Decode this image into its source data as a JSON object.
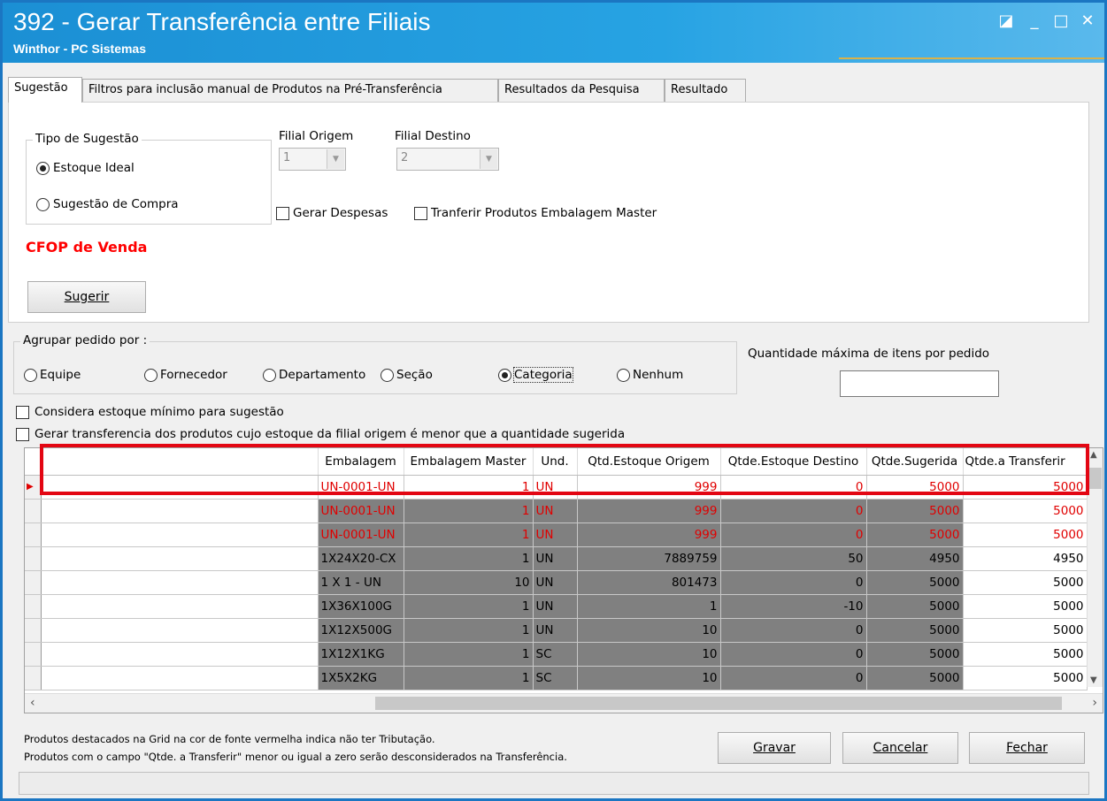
{
  "window": {
    "title": "392 - Gerar Transferência entre Filiais",
    "subtitle": "Winthor - PC Sistemas",
    "controls": {
      "restore": "◪",
      "minimize": "_",
      "maximize": "□",
      "close": "✕"
    }
  },
  "tabs": [
    {
      "label": "Sugestão",
      "active": true
    },
    {
      "label": "Filtros para inclusão manual de Produtos na Pré-Transferência",
      "active": false
    },
    {
      "label": "Resultados da Pesquisa",
      "active": false
    },
    {
      "label": "Resultado",
      "active": false
    }
  ],
  "sugestao": {
    "tipo_label": "Tipo de Sugestão",
    "opt_estoque": "Estoque Ideal",
    "opt_compra": "Sugestão de Compra",
    "filial_origem_label": "Filial Origem",
    "filial_origem_value": "1",
    "filial_destino_label": "Filial Destino",
    "filial_destino_value": "2",
    "gerar_despesas": "Gerar Despesas",
    "transferir_master": "Tranferir Produtos Embalagem Master",
    "cfop": "CFOP de Venda",
    "sugerir": "Sugerir"
  },
  "agrupar": {
    "label": "Agrupar pedido por :",
    "options": [
      "Equipe",
      "Fornecedor",
      "Departamento",
      "Seção",
      "Categoria",
      "Nenhum"
    ],
    "selected": "Categoria",
    "qtd_max_label": "Quantidade máxima de itens por pedido",
    "qtd_max_value": ""
  },
  "checks": {
    "estoque_minimo": "Considera estoque mínimo para sugestão",
    "gerar_menor": "Gerar transferencia dos produtos cujo estoque da filial origem é menor que a quantidade sugerida"
  },
  "grid": {
    "columns": [
      "",
      "Embalagem",
      "Embalagem Master",
      "Und.",
      "Qtd.Estoque Origem",
      "Qtde.Estoque Destino",
      "Qtde.Sugerida",
      "Qtde.a Transferir"
    ],
    "rows": [
      {
        "red": true,
        "embalagem": "UN-0001-UN",
        "master": "1",
        "und": "UN",
        "origem": "999",
        "destino": "0",
        "sugerida": "5000",
        "transferir": "5000"
      },
      {
        "red": true,
        "embalagem": "UN-0001-UN",
        "master": "1",
        "und": "UN",
        "origem": "999",
        "destino": "0",
        "sugerida": "5000",
        "transferir": "5000"
      },
      {
        "red": true,
        "embalagem": "UN-0001-UN",
        "master": "1",
        "und": "UN",
        "origem": "999",
        "destino": "0",
        "sugerida": "5000",
        "transferir": "5000"
      },
      {
        "red": false,
        "embalagem": "1X24X20-CX",
        "master": "1",
        "und": "UN",
        "origem": "7889759",
        "destino": "50",
        "sugerida": "4950",
        "transferir": "4950"
      },
      {
        "red": false,
        "embalagem": "1 X 1 - UN",
        "master": "10",
        "und": "UN",
        "origem": "801473",
        "destino": "0",
        "sugerida": "5000",
        "transferir": "5000"
      },
      {
        "red": false,
        "embalagem": "1X36X100G",
        "master": "1",
        "und": "UN",
        "origem": "1",
        "destino": "-10",
        "sugerida": "5000",
        "transferir": "5000"
      },
      {
        "red": false,
        "embalagem": "1X12X500G",
        "master": "1",
        "und": "UN",
        "origem": "10",
        "destino": "0",
        "sugerida": "5000",
        "transferir": "5000"
      },
      {
        "red": false,
        "embalagem": "1X12X1KG",
        "master": "1",
        "und": "SC",
        "origem": "10",
        "destino": "0",
        "sugerida": "5000",
        "transferir": "5000"
      },
      {
        "red": false,
        "embalagem": "1X5X2KG",
        "master": "1",
        "und": "SC",
        "origem": "10",
        "destino": "0",
        "sugerida": "5000",
        "transferir": "5000"
      }
    ]
  },
  "footer": {
    "note1": "Produtos destacados na Grid na cor de fonte vermelha indica não ter Tributação.",
    "note2": "Produtos com o campo \"Qtde. a Transferir\" menor ou igual a zero serão desconsiderados na Transferência.",
    "gravar": "Gravar",
    "cancelar": "Cancelar",
    "fechar": "Fechar"
  },
  "colors": {
    "title_bar": "#1b8fd4",
    "highlight": "#e30613",
    "no_tax_red": "#e00000"
  }
}
